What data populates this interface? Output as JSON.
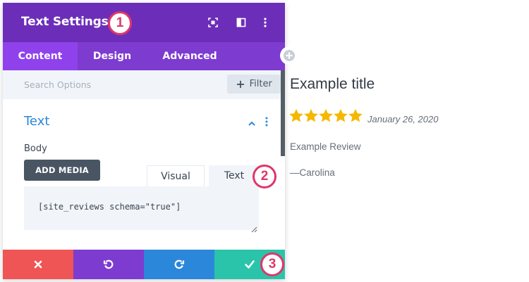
{
  "panel": {
    "title": "Text Settings",
    "tabs": [
      {
        "label": "Content",
        "active": true
      },
      {
        "label": "Design",
        "active": false
      },
      {
        "label": "Advanced",
        "active": false
      }
    ],
    "search": {
      "placeholder": "Search Options"
    },
    "filter_label": "Filter",
    "section": {
      "title": "Text",
      "field_label": "Body",
      "add_media_label": "ADD MEDIA",
      "editor_tabs": [
        "Visual",
        "Text"
      ],
      "editor_value": "[site_reviews schema=\"true\"]"
    },
    "footer": {
      "buttons": [
        {
          "name": "cancel",
          "color": "#ef5555"
        },
        {
          "name": "undo",
          "color": "#7e3bd0"
        },
        {
          "name": "redo",
          "color": "#2b87da"
        },
        {
          "name": "save",
          "color": "#29c4a9"
        }
      ]
    },
    "header_icons": [
      "expand-icon",
      "sidebar-toggle-icon",
      "more-vertical-icon"
    ]
  },
  "badges": [
    "1",
    "2",
    "3"
  ],
  "preview": {
    "title": "Example title",
    "rating": 5,
    "date": "January 26, 2020",
    "text": "Example Review",
    "author": "—Carolina"
  },
  "colors": {
    "header": "#6c2eb9",
    "tabs": "#7e3bd0",
    "active_tab": "#8f42ec",
    "accent_blue": "#2b87da",
    "badge": "#e0356b",
    "star": "#f5b800"
  }
}
